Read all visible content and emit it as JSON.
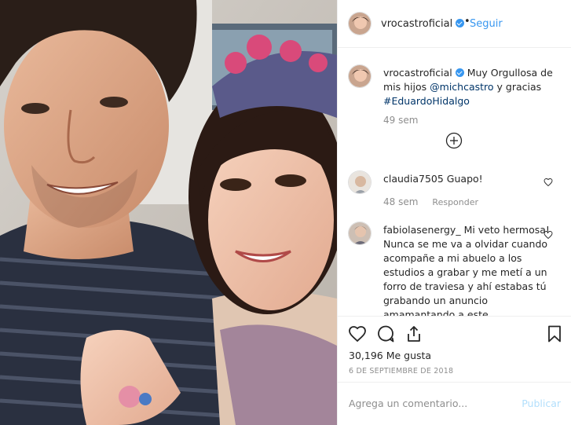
{
  "post": {
    "author": "vrocastroficial",
    "follow_dot": "•",
    "follow_label": "Seguir"
  },
  "caption": {
    "author": "vrocastroficial",
    "text_1": "Muy Orgullosa de mis hijos",
    "mention": "@michcastro",
    "text_2": "y gracias",
    "hashtag": "#EduardoHidalgo",
    "age": "49 sem"
  },
  "comments": [
    {
      "user": "claudia7505",
      "text": "Guapo!",
      "age": "48 sem",
      "reply_label": "Responder"
    },
    {
      "user": "fabiolasenergy_",
      "text": "Mi veto hermosa! Nunca se me va a olvidar cuando acompañe a mi abuelo a los estudios a grabar y me metí a un forro de traviesa y ahí estabas tú grabando un anuncio amamantando a este"
    }
  ],
  "stats": {
    "likes": "30,196 Me gusta",
    "date": "6 DE SEPTIEMBRE DE 2018"
  },
  "comment_box": {
    "placeholder": "Agrega un comentario...",
    "post_label": "Publicar"
  },
  "icons": {
    "verified": "verified-badge-icon",
    "like": "heart-icon",
    "comment": "comment-bubble-icon",
    "share": "share-icon",
    "save": "bookmark-icon",
    "load_more": "plus-circle-icon"
  },
  "colors": {
    "link": "#003569",
    "follow": "#3897f0",
    "muted": "#8e8e8e",
    "post_disabled": "#b2dffc"
  }
}
